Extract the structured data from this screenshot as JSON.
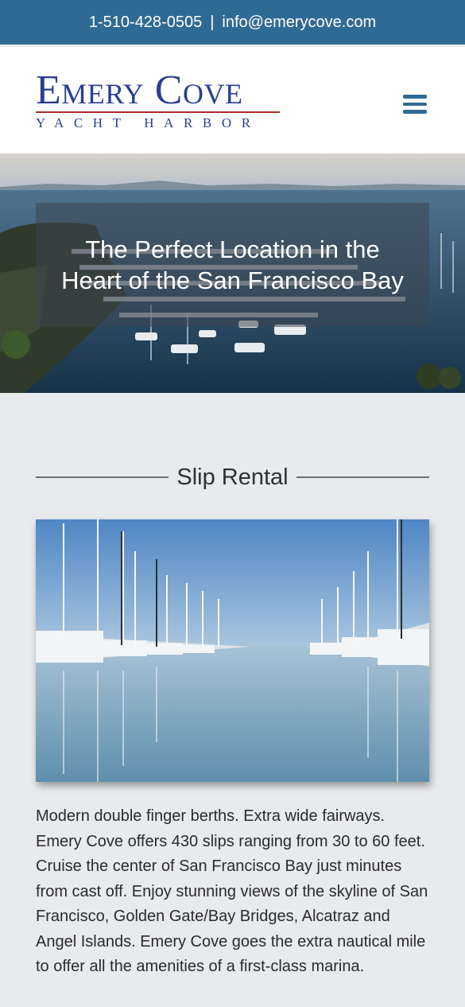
{
  "topbar": {
    "phone": "1-510-428-0505",
    "separator": "|",
    "email": "info@emerycove.com"
  },
  "header": {
    "logo_main": "Emery Cove",
    "logo_sub": "YACHT HARBOR",
    "menu_icon": "hamburger-menu-icon"
  },
  "hero": {
    "title": "The Perfect Location in the Heart of the San Francisco Bay"
  },
  "section": {
    "heading": "Slip Rental",
    "description": "Modern double finger berths. Extra wide fairways. Emery Cove offers 430 slips ranging from 30 to 60 feet. Cruise the center of San Francisco Bay just minutes from cast off. Enjoy stunning views of the skyline of San Francisco, Golden Gate/Bay Bridges, Alcatraz and Angel Islands. Emery Cove goes the extra nautical mile to offer all the amenities of a first-class marina."
  },
  "colors": {
    "topbar_bg": "#2f6a94",
    "logo_blue": "#2a3f8f",
    "logo_red": "#b22a2a",
    "page_bg": "#e9eaec"
  }
}
